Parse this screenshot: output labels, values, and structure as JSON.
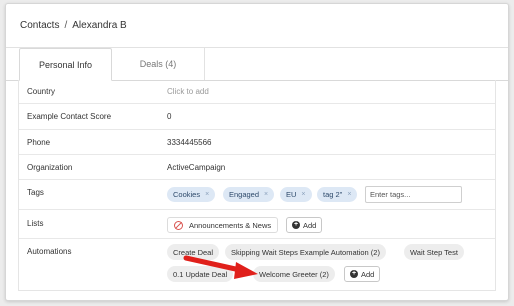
{
  "header": {
    "breadcrumb_root": "Contacts",
    "separator": "/",
    "contact_name": "Alexandra B"
  },
  "tabs": [
    {
      "label": "Personal Info",
      "active": true
    },
    {
      "label": "Deals (4)",
      "active": false
    }
  ],
  "fields": {
    "country": {
      "label": "Country",
      "value": "Click to add"
    },
    "score": {
      "label": "Example Contact Score",
      "value": "0"
    },
    "phone": {
      "label": "Phone",
      "value": "3334445566"
    },
    "organization": {
      "label": "Organization",
      "value": "ActiveCampaign"
    },
    "tags": {
      "label": "Tags",
      "items": [
        "Cookies",
        "Engaged",
        "EU",
        "tag 2\""
      ],
      "remove_glyph": "×",
      "input_placeholder": "Enter tags..."
    },
    "lists": {
      "label": "Lists",
      "items": [
        "Announcements & News"
      ],
      "add_label": "Add"
    },
    "automations": {
      "label": "Automations",
      "items": [
        "Create Deal",
        "Skipping Wait Steps Example Automation (2)",
        "Wait Step Test",
        "0.1 Update Deal",
        "Welcome Greeter (2)"
      ],
      "add_label": "Add"
    }
  },
  "colors": {
    "tag_bg": "#dde8f5",
    "automation_bg": "#ededed",
    "annotation_arrow": "#e0201b",
    "list_icon": "#d9534f"
  },
  "icons": {
    "list_status": "no-entry-icon",
    "add": "plus-circle-icon",
    "annotation": "arrow-annotation"
  }
}
